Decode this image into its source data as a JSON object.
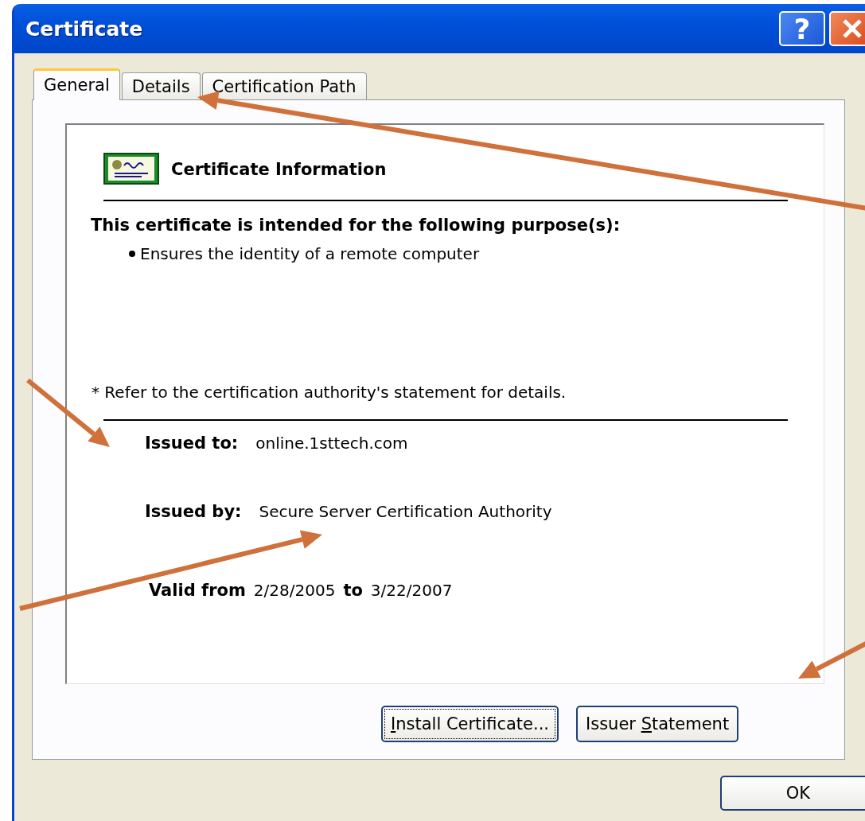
{
  "window": {
    "title": "Certificate"
  },
  "title_buttons": [
    {
      "kind": "help",
      "glyph": "?"
    },
    {
      "kind": "close"
    }
  ],
  "tabs": [
    {
      "label": "General",
      "selected": true
    },
    {
      "label": "Details",
      "selected": false
    },
    {
      "label": "Certification Path",
      "selected": false
    }
  ],
  "certificate_info": {
    "heading": "Certificate Information",
    "purpose_heading": "This certificate is intended for the following purpose(s):",
    "purposes": [
      "Ensures the identity of a remote computer"
    ],
    "note": "* Refer to the certification authority's statement for details.",
    "issued_to": {
      "label": "Issued to:",
      "value": "online.1sttech.com"
    },
    "issued_by": {
      "label": "Issued by:",
      "value": "Secure Server Certification Authority"
    },
    "validity": {
      "from_label": "Valid from",
      "from": "2/28/2005",
      "to_label": "to",
      "to": "3/22/2007"
    }
  },
  "buttons": [
    {
      "label": {
        "key": "I",
        "post": "nstall Certificate..."
      },
      "focused": true
    },
    {
      "label": {
        "pre": "Issuer ",
        "key": "S",
        "post": "tatement"
      },
      "focused": false
    }
  ],
  "dialog_buttons": [
    {
      "label": "OK"
    }
  ]
}
